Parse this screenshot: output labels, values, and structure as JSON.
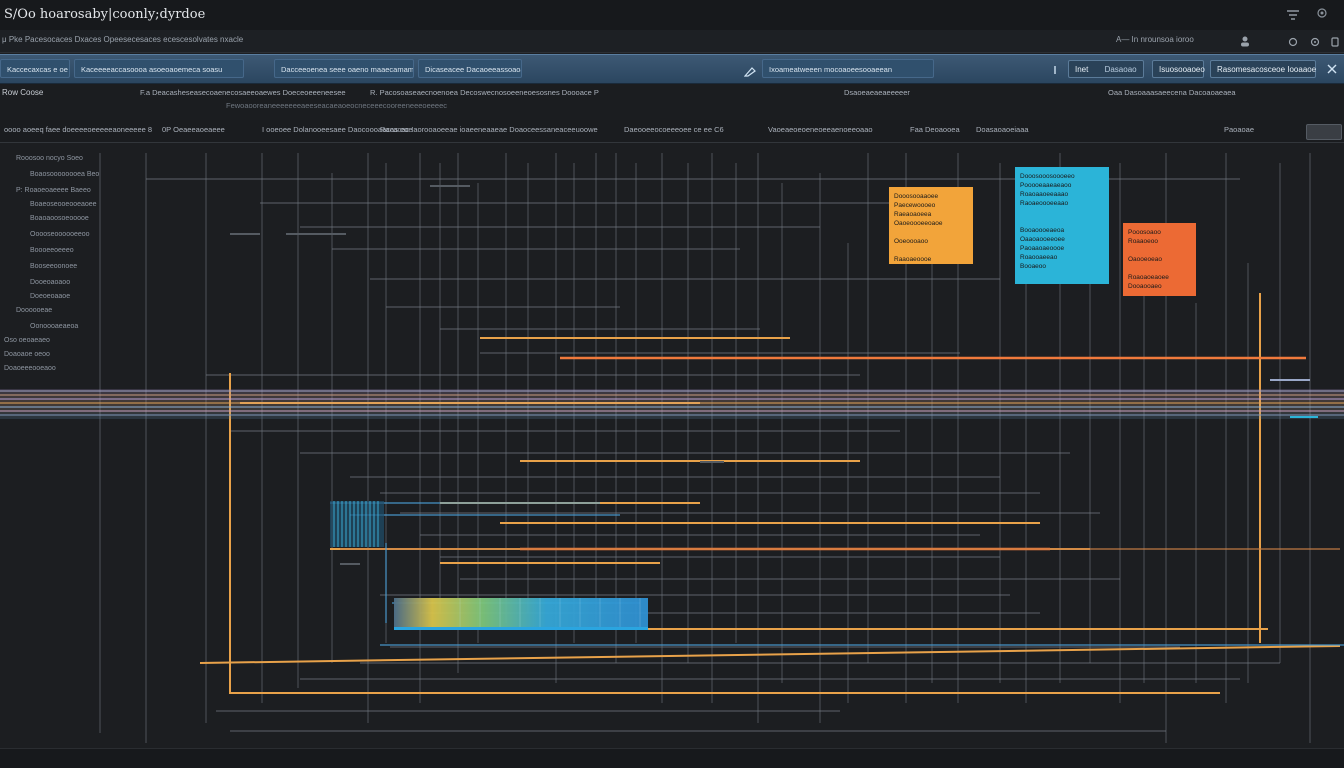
{
  "window": {
    "title": "S/Oo hoarosaby|coonly;dyrdoe"
  },
  "menubar": {
    "breadcrumb": "μ Pke Pacesocaces Dxaces Opeesecesaces ecescesolvates nxacle",
    "account_label": "A— In  nrounsoa  ioroo",
    "icons": [
      "user-icon",
      "settings-icon",
      "close-icon"
    ]
  },
  "toolbar": {
    "segments": [
      "Kaccecaxcas  e  oe",
      "Kaceeeeaccasoooa  asoeoaoemeca soasu",
      "Dacceeoenea  seee  oaeno  maaecamam",
      "Dicaseacee  Dacaoeeassoaoaovaoaeao",
      "Ixoameatweeen  mocoaoeesooaeean"
    ],
    "btn_a": "Inet",
    "btn_a_sub": "Dasaoao",
    "btn_b": "Isuosooaoeo",
    "btn_c": "Rasomesacosceoe  Iooaaoe"
  },
  "columns": {
    "row1": [
      "Row Coose",
      "F.a Deacasheseasecoaenecosaeeoaewes  Doeceoeeeneesee",
      "R. Pacosoaseaecnoenoea  Decoswecnosoeeneoesosnes  Doooace  P",
      "Dsaoeaeaeaeeeeer",
      "Oaa  Dasoaaasaeecena  Dacoaoaeaea"
    ],
    "row1b": "Fewoaooreaneeeeeeeaeeseacaeaoeocneceeecooreeneeeoeeeec",
    "row2": [
      "oooo aoeeq faee  doeeeeoeeeeeaoneeeee 8",
      "0P Oeaeeaoeaeee",
      "I ooeoee  Dolanooeesaee  Daocoooaacas  eoe",
      "Racacac  Iaorooaoeeae  ioaeeneaaeae  Doaoceessaneaceeuoowe",
      "Daeooeeocoeeeoee  ce ee  C6",
      "Vaoeaeoeoeneoeeaenoeeoaao",
      "Faa  Deoaooea",
      "Doasaoaoeiaaa",
      "Paoaoae"
    ]
  },
  "sidebar": {
    "items": [
      "Rooosoo nocyo Soeo",
      "Boaosoooooooea  Beo",
      "P:  Roaoeoaeeee  Baeeo",
      "Boaeoseooeooeaoee",
      "Boaoaoosoeooooe",
      "Ooooseoooooeeoo",
      "Boooeeoeeeo",
      "Booseeoonoee",
      "Dooeoaoaoo",
      "Doeoeoaaoe",
      "Doooooeae",
      "Oonoooaeaeoa",
      "Oso oeoaeaeo",
      "Doaoaoe  oeoo",
      "Doaoeeeooeaoo"
    ]
  },
  "notes": [
    {
      "color": "#f2a43a",
      "lines": [
        "Dooosooaaoee",
        "Paecewoooeo",
        "Raeaoaoeea",
        "Oaoeoooeeoaoe",
        "",
        "Ooeoooaoo",
        "",
        "Raaoaeoooe",
        "Roaaooeaoo"
      ]
    },
    {
      "color": "#2bb4d8",
      "lines": [
        "Dooosooosoooeeo",
        "Pooooeaaeaeaoo",
        "Roaoaaoeeaaao",
        "Raoaeoooeeaao",
        "",
        "",
        "Booaoooeaeoa",
        "Oaaoaooeeoee",
        "Paoaaoaeoooe",
        "Roaooaeeao",
        "Booaeoo"
      ]
    },
    {
      "color": "#ec6a34",
      "lines": [
        "Pooosoaoo",
        "Roaaoeoo",
        "",
        "Oaooeoeao",
        "",
        "Roaoaoeaoee",
        "Dooaooaeo"
      ]
    }
  ]
}
